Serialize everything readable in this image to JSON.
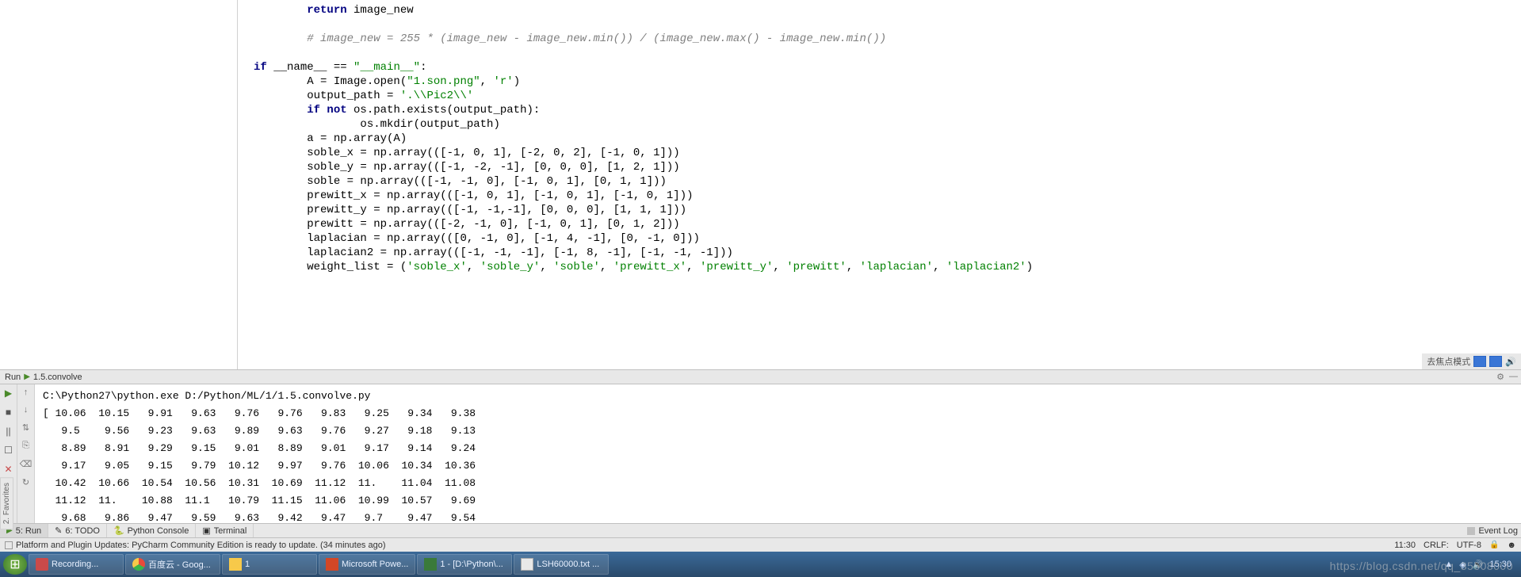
{
  "side_tab_label": "2. Favorites",
  "editor": {
    "lines": [
      {
        "indent": 2,
        "spans": [
          {
            "t": "return ",
            "c": "kw"
          },
          {
            "t": "image_new"
          }
        ]
      },
      {
        "indent": 0,
        "spans": [
          {
            "t": " "
          }
        ]
      },
      {
        "indent": 2,
        "spans": [
          {
            "t": "# image_new = 255 * (image_new - image_new.min()) / (image_new.max() - image_new.min())",
            "c": "cmt"
          }
        ]
      },
      {
        "indent": 0,
        "spans": [
          {
            "t": " "
          }
        ]
      },
      {
        "indent": 0,
        "spans": [
          {
            "t": "if ",
            "c": "kw"
          },
          {
            "t": "__name__ == "
          },
          {
            "t": "\"__main__\"",
            "c": "str"
          },
          {
            "t": ":"
          }
        ]
      },
      {
        "indent": 2,
        "spans": [
          {
            "t": "A = Image.open("
          },
          {
            "t": "\"1.son.png\"",
            "c": "str"
          },
          {
            "t": ", "
          },
          {
            "t": "'r'",
            "c": "str"
          },
          {
            "t": ")"
          }
        ]
      },
      {
        "indent": 2,
        "spans": [
          {
            "t": "output_path = "
          },
          {
            "t": "'.\\\\Pic2\\\\'",
            "c": "str"
          }
        ]
      },
      {
        "indent": 2,
        "spans": [
          {
            "t": "if not ",
            "c": "kw"
          },
          {
            "t": "os.path.exists(output_path):"
          }
        ]
      },
      {
        "indent": 4,
        "spans": [
          {
            "t": "os.mkdir(output_path)"
          }
        ]
      },
      {
        "indent": 2,
        "spans": [
          {
            "t": "a = np.array(A)"
          }
        ]
      },
      {
        "indent": 2,
        "spans": [
          {
            "t": "soble_x = np.array(([-1, 0, 1], [-2, 0, 2], [-1, 0, 1]))"
          }
        ]
      },
      {
        "indent": 2,
        "spans": [
          {
            "t": "soble_y = np.array(([-1, -2, -1], [0, 0, 0], [1, 2, 1]))"
          }
        ]
      },
      {
        "indent": 2,
        "spans": [
          {
            "t": "soble = np.array(([-1, -1, 0], [-1, 0, 1], [0, 1, 1]))"
          }
        ]
      },
      {
        "indent": 2,
        "spans": [
          {
            "t": "prewitt_x = np.array(([-1, 0, 1], [-1, 0, 1], [-1, 0, 1]))"
          }
        ]
      },
      {
        "indent": 2,
        "spans": [
          {
            "t": "prewitt_y = np.array(([-1, -1,-1], [0, 0, 0], [1, 1, 1]))"
          }
        ]
      },
      {
        "indent": 2,
        "spans": [
          {
            "t": "prewitt = np.array(([-2, -1, 0], [-1, 0, 1], [0, 1, 2]))"
          }
        ]
      },
      {
        "indent": 2,
        "spans": [
          {
            "t": "laplacian = np.array(([0, -1, 0], [-1, 4, -1], [0, -1, 0]))"
          }
        ]
      },
      {
        "indent": 2,
        "spans": [
          {
            "t": "laplacian2 = np.array(([-1, -1, -1], [-1, 8, -1], [-1, -1, -1]))"
          }
        ]
      },
      {
        "indent": 2,
        "spans": [
          {
            "t": "weight_list = ("
          },
          {
            "t": "'soble_x'",
            "c": "str"
          },
          {
            "t": ", "
          },
          {
            "t": "'soble_y'",
            "c": "str"
          },
          {
            "t": ", "
          },
          {
            "t": "'soble'",
            "c": "str"
          },
          {
            "t": ", "
          },
          {
            "t": "'prewitt_x'",
            "c": "str"
          },
          {
            "t": ", "
          },
          {
            "t": "'prewitt_y'",
            "c": "str"
          },
          {
            "t": ", "
          },
          {
            "t": "'prewitt'",
            "c": "str"
          },
          {
            "t": ", "
          },
          {
            "t": "'laplacian'",
            "c": "str"
          },
          {
            "t": ", "
          },
          {
            "t": "'laplacian2'",
            "c": "str"
          },
          {
            "t": ")"
          }
        ]
      }
    ],
    "float_label": "去焦点模式"
  },
  "run_panel": {
    "header_left": "Run",
    "header_config": "1.5.convolve",
    "cmd_line": "C:\\Python27\\python.exe D:/Python/ML/1/1.5.convolve.py",
    "rows": [
      "[ 10.06  10.15   9.91   9.63   9.76   9.76   9.83   9.25   9.34   9.38",
      "   9.5    9.56   9.23   9.63   9.89   9.63   9.76   9.27   9.18   9.13",
      "   8.89   8.91   9.29   9.15   9.01   8.89   9.01   9.17   9.14   9.24",
      "   9.17   9.05   9.15   9.79  10.12   9.97   9.76  10.06  10.34  10.36",
      "  10.42  10.66  10.54  10.56  10.31  10.69  11.12  11.    11.04  11.08",
      "  11.12  11.    10.88  11.1   10.79  11.15  11.06  10.99  10.57   9.69",
      "   9.68   9.86   9.47   9.59   9.63   9.42   9.47   9.7    9.47   9.54"
    ],
    "ctrl1": [
      "▶",
      "■",
      "||",
      "☐",
      "✕",
      "?"
    ],
    "ctrl2": [
      "↑",
      "↓",
      "⇅",
      "⎘",
      "⌫",
      "↻"
    ]
  },
  "bottom_tabs": {
    "run": "5: Run",
    "todo": "6: TODO",
    "python_console": "Python Console",
    "terminal": "Terminal",
    "event_log": "Event Log"
  },
  "status_bar": {
    "msg": "Platform and Plugin Updates: PyCharm Community Edition is ready to update. (34 minutes ago)",
    "pos": "11:30",
    "eol": "CRLF:",
    "enc": "UTF-8"
  },
  "taskbar": {
    "items": [
      {
        "label": "Recording...",
        "icon": "icon-rec"
      },
      {
        "label": "百度云 - Goog...",
        "icon": "icon-chrome"
      },
      {
        "label": "1",
        "icon": "icon-folder"
      },
      {
        "label": "Microsoft Powe...",
        "icon": "icon-ppt"
      },
      {
        "label": "1 - [D:\\Python\\...",
        "icon": "icon-py"
      },
      {
        "label": "LSH60000.txt ...",
        "icon": "icon-txt"
      }
    ],
    "tray_time": "15:30"
  },
  "watermark": "https://blog.csdn.net/qq_35608000"
}
